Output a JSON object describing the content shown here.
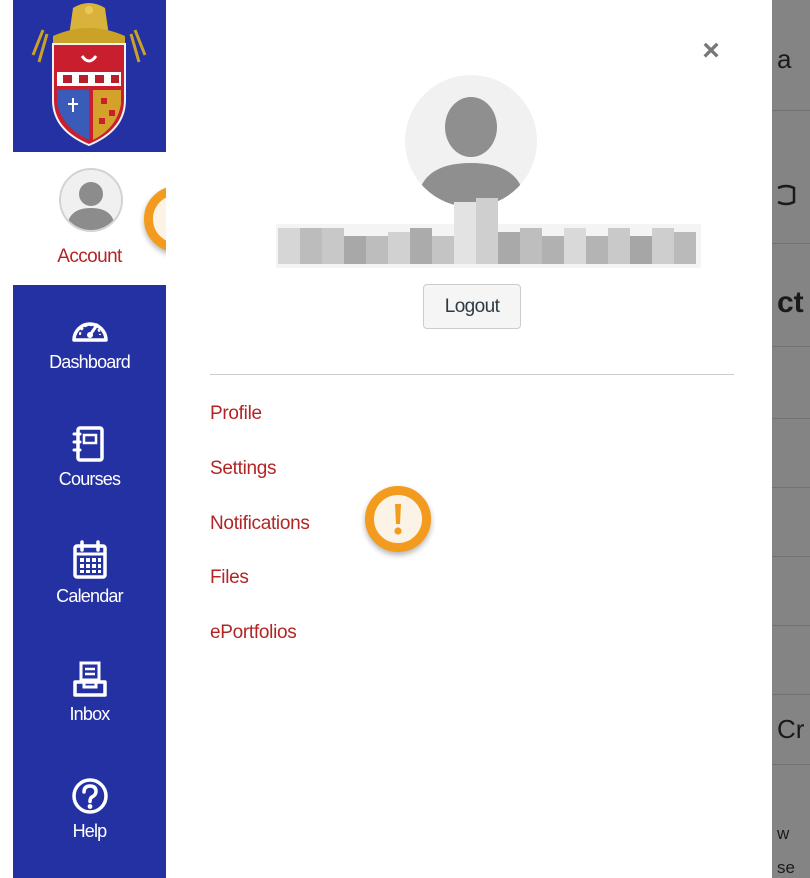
{
  "sidebar": {
    "account_label": "Account",
    "items": [
      {
        "label": "Dashboard",
        "icon": "dashboard-icon"
      },
      {
        "label": "Courses",
        "icon": "courses-icon"
      },
      {
        "label": "Calendar",
        "icon": "calendar-icon"
      },
      {
        "label": "Inbox",
        "icon": "inbox-icon"
      },
      {
        "label": "Help",
        "icon": "help-icon"
      }
    ]
  },
  "tray": {
    "close_label": "×",
    "logout_label": "Logout",
    "links": [
      {
        "label": "Profile"
      },
      {
        "label": "Settings"
      },
      {
        "label": "Notifications"
      },
      {
        "label": "Files"
      },
      {
        "label": "ePortfolios"
      }
    ]
  },
  "background": {
    "fragments": [
      "a",
      "",
      "ct",
      "Cr",
      "w",
      "se"
    ]
  },
  "colors": {
    "sidebar": "#2431a2",
    "link": "#b32425",
    "badge_ring": "#f39b1e",
    "badge_mark": "#f39b1e"
  }
}
